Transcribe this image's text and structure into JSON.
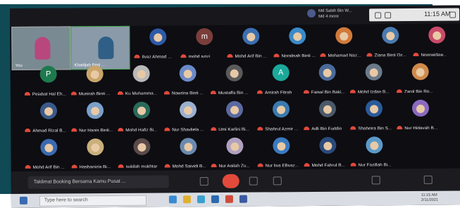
{
  "topbar": {
    "host_line1": "Md Saleh Bin W...",
    "host_line2": "Md 4 more",
    "time": "11:15 AM"
  },
  "videos": [
    {
      "label": "You"
    },
    {
      "label": "Khadijah Binti ..."
    }
  ],
  "participants": [
    {
      "name": "Ilyaz Ahmad ...",
      "avatar_color": "#2d5aa8",
      "letter": ""
    },
    {
      "name": "mohd azizi",
      "avatar_color": "#7a3e3a",
      "letter": "m"
    },
    {
      "name": "Mohd Arif Bin ...",
      "avatar_color": "#3b6fb0",
      "letter": ""
    },
    {
      "name": "Noralisah Binti ...",
      "avatar_color": "#3a8ac9",
      "letter": ""
    },
    {
      "name": "Mohamad Naz...",
      "avatar_color": "#d07a3a",
      "letter": ""
    },
    {
      "name": "Ziana Binti Oz...",
      "avatar_color": "#4a7ab0",
      "letter": ""
    },
    {
      "name": "Noorwidaw...",
      "avatar_color": "#c94a6a",
      "letter": ""
    },
    {
      "name": "Pejabat Hal Eh...",
      "avatar_color": "#1e7a4e",
      "letter": "P"
    },
    {
      "name": "Munirah Binti ...",
      "avatar_color": "#c9a46a",
      "letter": ""
    },
    {
      "name": "Ku Muhamma...",
      "avatar_color": "#b9b9b9",
      "letter": ""
    },
    {
      "name": "Nowrina Binti ...",
      "avatar_color": "#6a8ac9",
      "letter": ""
    },
    {
      "name": "Mustaffa Bin ...",
      "avatar_color": "#5a5a5a",
      "letter": ""
    },
    {
      "name": "Amirah Fitrah",
      "avatar_color": "#1aa99a",
      "letter": "A"
    },
    {
      "name": "Faisal Bin Baki...",
      "avatar_color": "#4a6a9a",
      "letter": ""
    },
    {
      "name": "Mohd Izdan B...",
      "avatar_color": "#6a7a8a",
      "letter": ""
    },
    {
      "name": "Zarol Bin Ro...",
      "avatar_color": "#d08a4a",
      "letter": ""
    },
    {
      "name": "Ahmad Rizal B...",
      "avatar_color": "#3a5a8a",
      "letter": ""
    },
    {
      "name": "Nur Hanis Binti...",
      "avatar_color": "#7aa0c9",
      "letter": ""
    },
    {
      "name": "Mohd Hafiz Bi...",
      "avatar_color": "#2a6a5a",
      "letter": ""
    },
    {
      "name": "Nur Shayliela ...",
      "avatar_color": "#9ab0d0",
      "letter": ""
    },
    {
      "name": "Umi Karlini Bi...",
      "avatar_color": "#5a6aa0",
      "letter": ""
    },
    {
      "name": "Shahrul Azmir ...",
      "avatar_color": "#3a7ab0",
      "letter": ""
    },
    {
      "name": "Adli Bin Fuddin",
      "avatar_color": "#4a5a6a",
      "letter": ""
    },
    {
      "name": "Shaheira Bin S...",
      "avatar_color": "#2a5a9a",
      "letter": ""
    },
    {
      "name": "Nur Hidayah B...",
      "avatar_color": "#8a6ac0",
      "letter": ""
    },
    {
      "name": "Mohd Arif Bin ...",
      "avatar_color": "#3a6ab0",
      "letter": ""
    },
    {
      "name": "Hasbanizia Bi...",
      "avatar_color": "#c9b07a",
      "letter": ""
    },
    {
      "name": "sukilah mukhtar",
      "avatar_color": "#5a4a4a",
      "letter": ""
    },
    {
      "name": "Mohd Saiyidi B...",
      "avatar_color": "#6a8ab0",
      "letter": ""
    },
    {
      "name": "Nur Aqilah Zu...",
      "avatar_color": "#b0a0c0",
      "letter": ""
    },
    {
      "name": "Nur Iiya Elliyaz...",
      "avatar_color": "#3a7ac0",
      "letter": ""
    },
    {
      "name": "Mohd Fahrul B...",
      "avatar_color": "#2a4a7a",
      "letter": ""
    },
    {
      "name": "Nur Fazillah Bi...",
      "avatar_color": "#5a9ac9",
      "letter": ""
    }
  ],
  "controls": {
    "message_placeholder": "Taklimat Booking Bersama Kamu Pusat ..."
  },
  "taskbar": {
    "search_placeholder": "Type here to search",
    "time": "11:15 AM",
    "date": "2/11/2021"
  }
}
